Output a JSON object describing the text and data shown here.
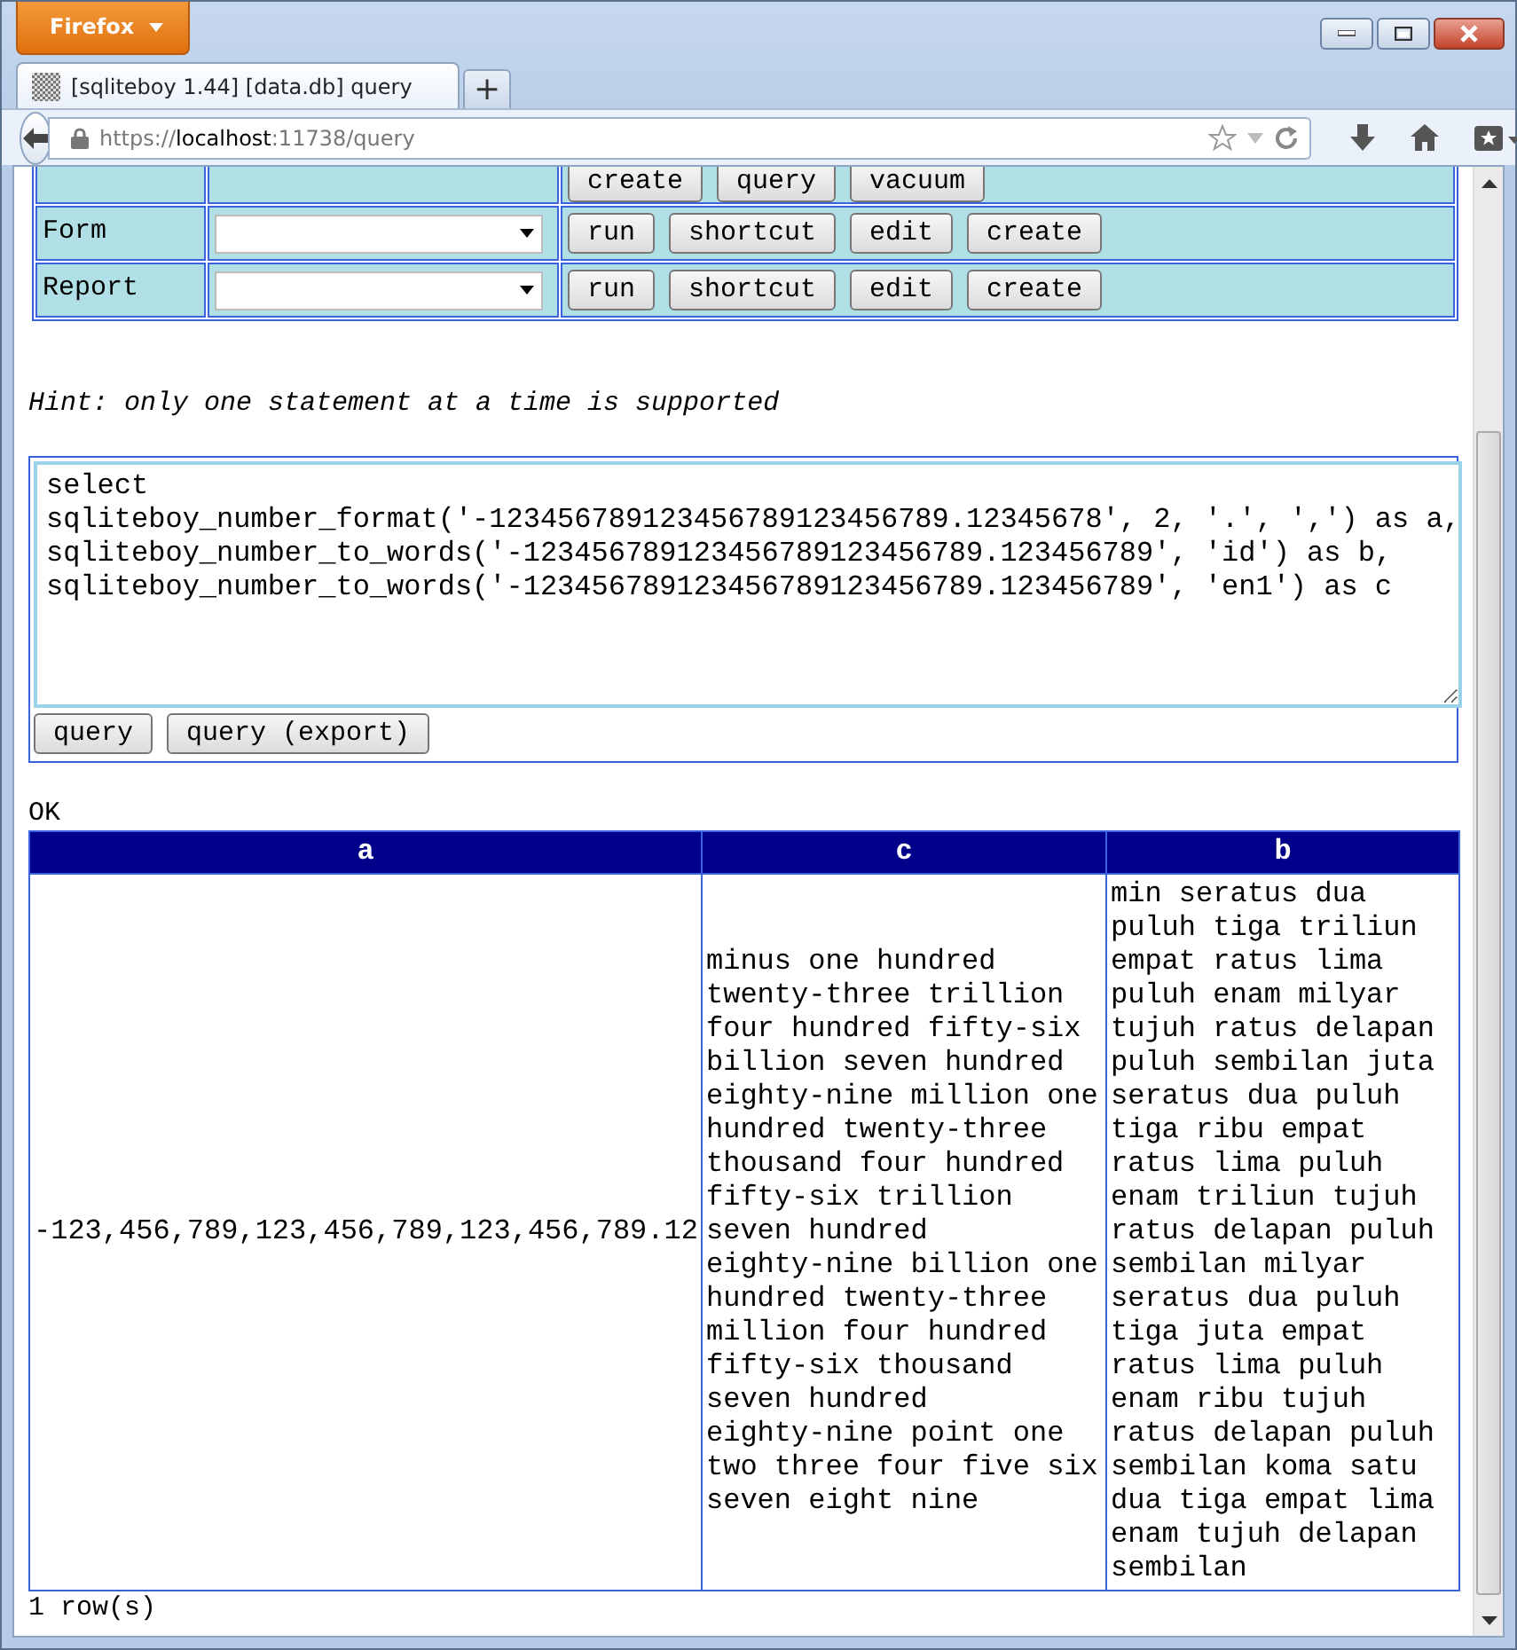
{
  "browser": {
    "menu_button": "Firefox",
    "tab_title": "[sqliteboy 1.44] [data.db] query",
    "new_tab": "+",
    "url": {
      "scheme": "https://",
      "host": "localhost",
      "rest": ":11738/query"
    }
  },
  "objects": [
    {
      "kind": "partial",
      "buttons": [
        "create",
        "query",
        "vacuum"
      ]
    },
    {
      "kind": "full",
      "label": "Form",
      "buttons": [
        "run",
        "shortcut",
        "edit",
        "create"
      ]
    },
    {
      "kind": "full",
      "label": "Report",
      "buttons": [
        "run",
        "shortcut",
        "edit",
        "create"
      ]
    }
  ],
  "hint": "Hint: only one statement at a time is supported",
  "query_text": "select\nsqliteboy_number_format('-123456789123456789123456789.12345678', 2, '.', ',') as a,\nsqliteboy_number_to_words('-123456789123456789123456789.123456789', 'id') as b,\nsqliteboy_number_to_words('-123456789123456789123456789.123456789', 'en1') as c",
  "query_buttons": [
    "query",
    "query (export)"
  ],
  "status": "OK",
  "result": {
    "columns": [
      "a",
      "c",
      "b"
    ],
    "rows": [
      [
        "-123,456,789,123,456,789,123,456,789.12",
        "minus one hundred twenty-three trillion four hundred fifty-six billion seven hundred eighty-nine million one hundred twenty-three thousand four hundred fifty-six trillion seven hundred eighty-nine billion one hundred twenty-three million four hundred fifty-six thousand seven hundred eighty-nine point one two three four five six seven eight nine",
        "min seratus dua puluh tiga triliun empat ratus lima puluh enam milyar tujuh ratus delapan puluh sembilan juta seratus dua puluh tiga ribu empat ratus lima puluh enam triliun tujuh ratus delapan puluh sembilan milyar seratus dua puluh tiga juta empat ratus lima puluh enam ribu tujuh ratus delapan puluh sembilan koma satu dua tiga empat lima enam tujuh delapan sembilan"
      ]
    ]
  },
  "row_count": "1 row(s)"
}
